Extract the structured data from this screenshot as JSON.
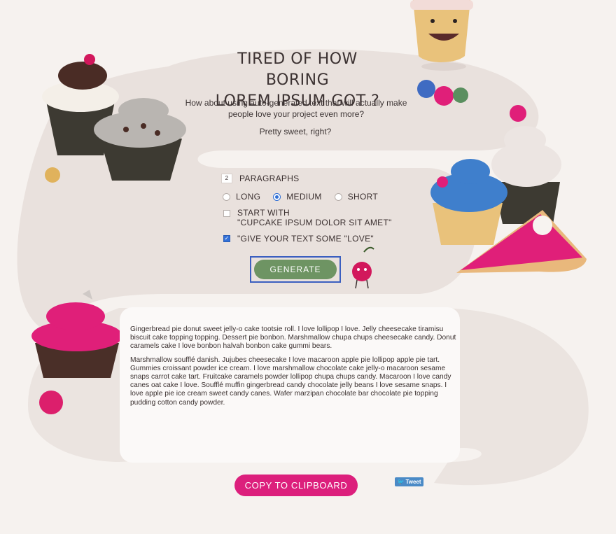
{
  "headline": {
    "line1": "TIRED OF HOW BORING",
    "line2": "LOREM IPSUM GOT ?"
  },
  "subtitle": "How about using auto-generated text that will actually make people love your project even more?",
  "tagline": "Pretty sweet, right?",
  "options": {
    "paragraph_count": "2",
    "paragraphs_label": "PARAGRAPHS",
    "length": [
      {
        "label": "LONG",
        "selected": false
      },
      {
        "label": "MEDIUM",
        "selected": true
      },
      {
        "label": "SHORT",
        "selected": false
      }
    ],
    "start_with_line1": "START WITH",
    "start_with_line2": "\"CUPCAKE IPSUM DOLOR SIT AMET\"",
    "start_with_checked": false,
    "love_label": "\"GIVE YOUR TEXT SOME \"LOVE\"",
    "love_checked": true
  },
  "generate_label": "GENERATE",
  "output": {
    "paragraphs": [
      "Gingerbread pie donut sweet jelly-o cake tootsie roll. I love lollipop I love. Jelly cheesecake tiramisu biscuit cake topping topping. Dessert pie bonbon. Marshmallow chupa chups cheesecake candy. Donut caramels cake I love bonbon halvah bonbon cake gummi bears.",
      "Marshmallow soufflé danish. Jujubes cheesecake I love macaroon apple pie lollipop apple pie tart. Gummies croissant powder ice cream. I love marshmallow chocolate cake jelly-o macaroon sesame snaps carrot cake tart. Fruitcake caramels powder lollipop chupa chups candy. Macaroon I love candy canes oat cake I love. Soufflé muffin gingerbread candy chocolate jelly beans I love sesame snaps. I love apple pie ice cream sweet candy canes. Wafer marzipan chocolate bar chocolate pie topping pudding cotton candy powder."
    ]
  },
  "copy_label": "COPY TO CLIPBOARD",
  "tweet_label": "Tweet",
  "colors": {
    "accent_pink": "#dc1f7c",
    "generate_green": "#6e9463",
    "tweet_blue": "#4a8ac6",
    "path_beige": "#e8e0dc"
  }
}
